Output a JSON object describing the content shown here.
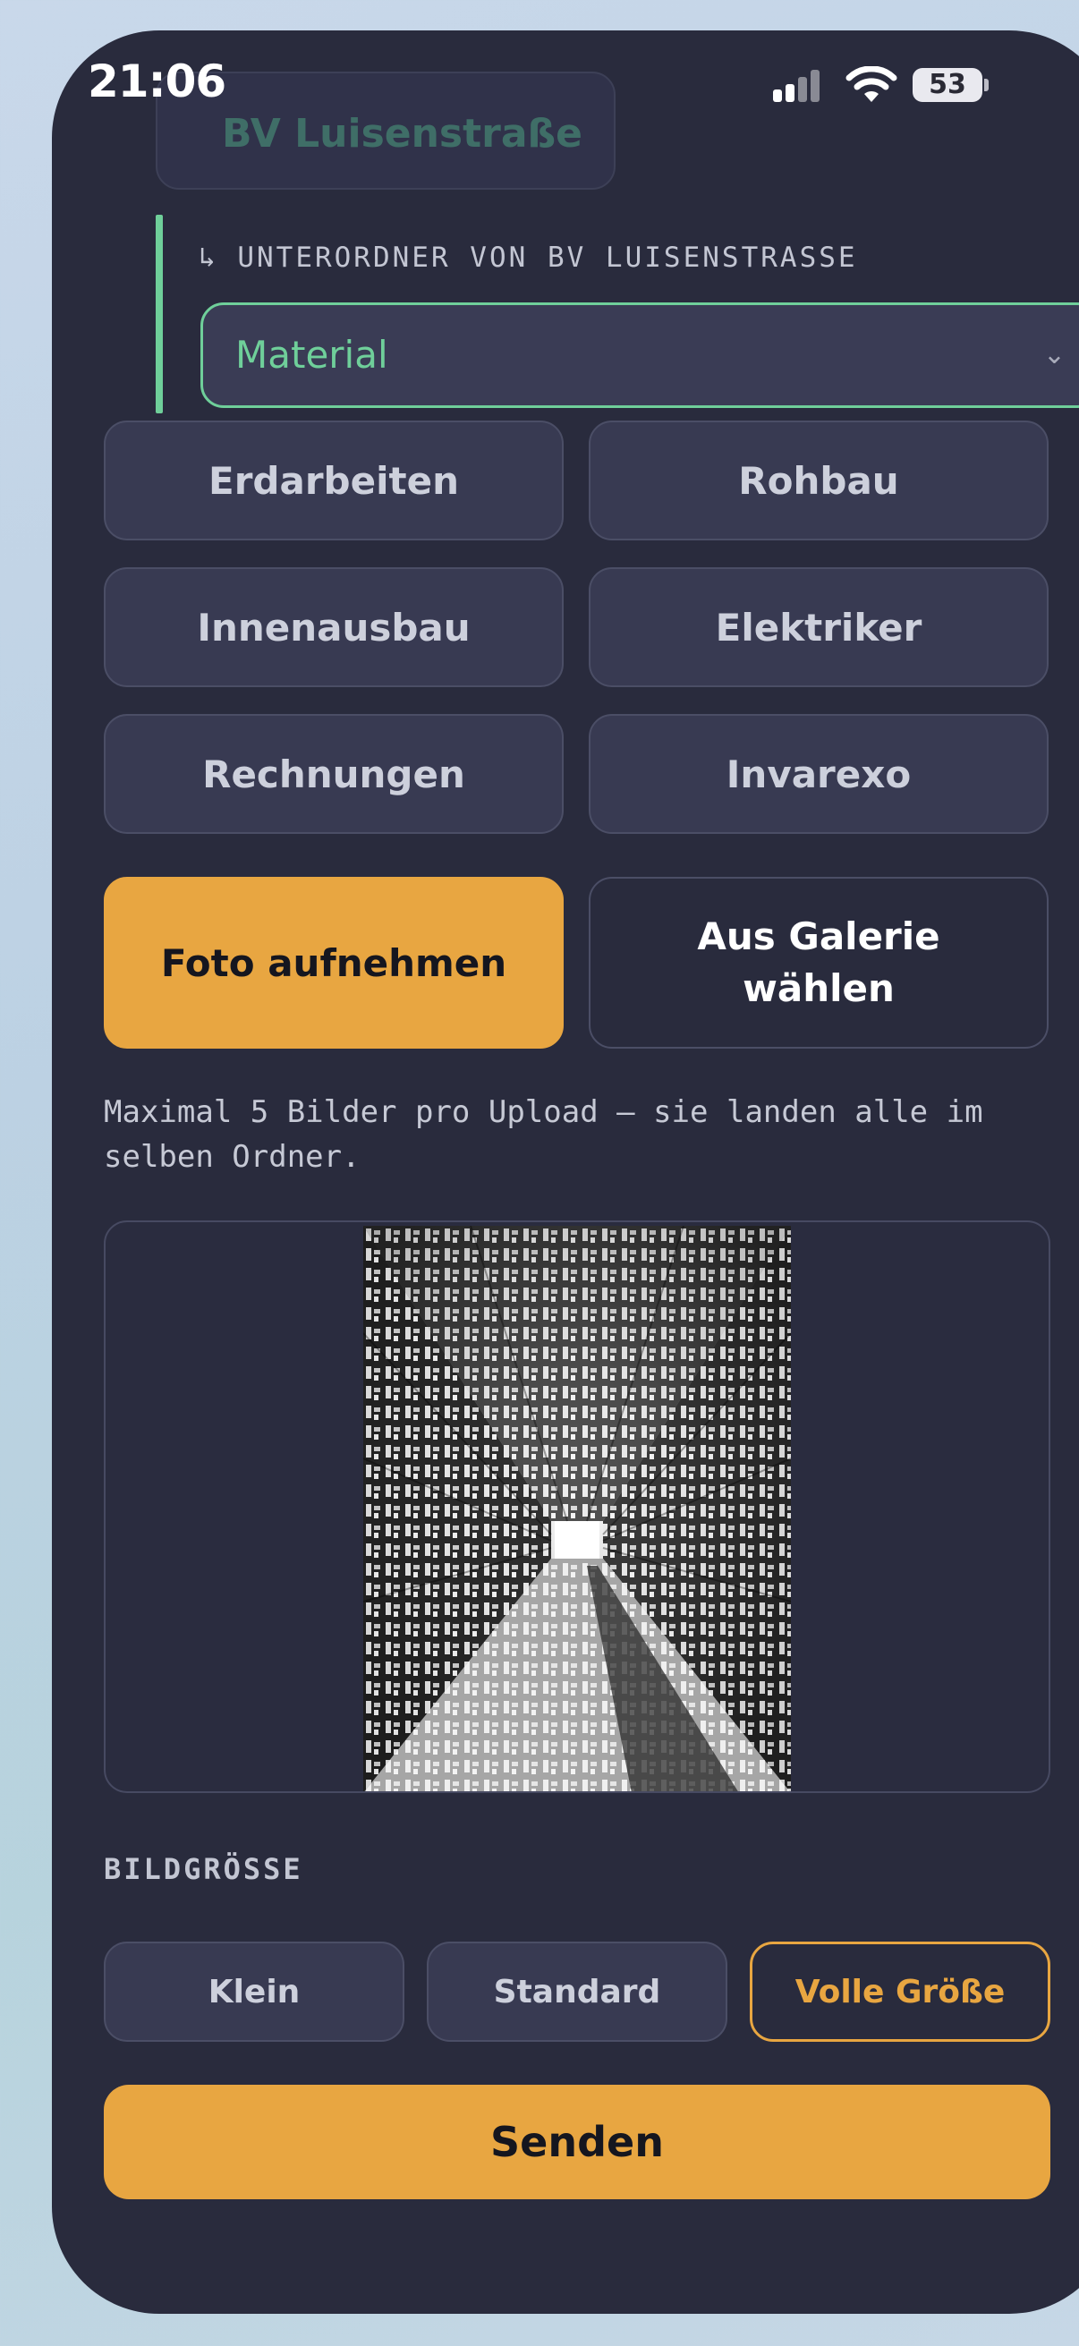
{
  "status": {
    "time": "21:06",
    "battery": "53",
    "signal_icon": "cellular-signal-icon",
    "wifi_icon": "wifi-icon"
  },
  "previous_folder": {
    "label": "BV Luisenstraße"
  },
  "subfolder": {
    "heading": "↳ UNTERORDNER VON BV LUISENSTRASSE",
    "selected": "Material",
    "accent_color": "#6fcf9a"
  },
  "folders": [
    "Erdarbeiten",
    "Rohbau",
    "Innenausbau",
    "Elektriker",
    "Rechnungen",
    "Invarexo"
  ],
  "actions": {
    "camera": "Foto aufnehmen",
    "gallery": "Aus Galerie wählen"
  },
  "hint": "Maximal 5 Bilder pro Upload – sie landen alle im selben Ordner.",
  "image_size": {
    "label": "BILDGRÖSSE",
    "options": [
      "Klein",
      "Standard",
      "Volle Größe"
    ],
    "selected": "Volle Größe"
  },
  "submit": "Senden",
  "colors": {
    "primary": "#e8a641",
    "background": "#292b3d",
    "accent": "#6fcf9a"
  }
}
